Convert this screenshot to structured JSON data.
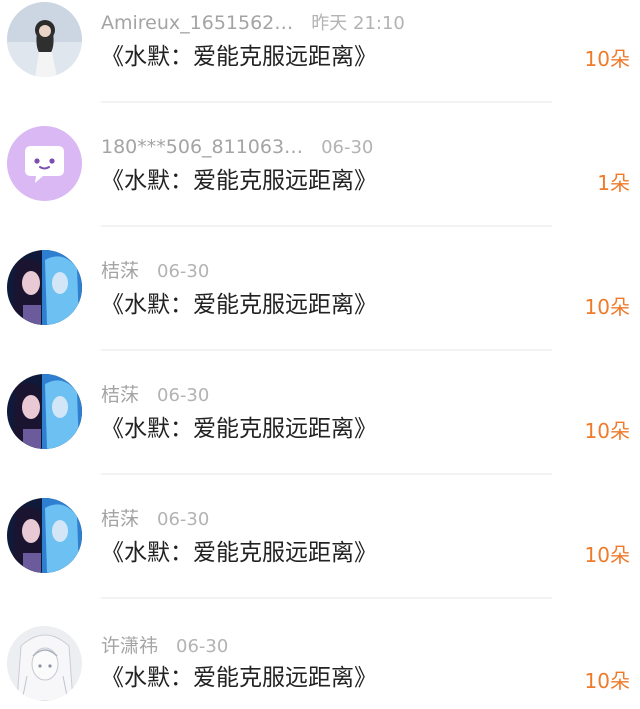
{
  "comments": [
    {
      "user": "Amireux_1651562…",
      "time": "昨天  21:10",
      "title": "《水默：爱能克服远距离》",
      "gift": "10朵",
      "avatar": "girl-photo-avatar"
    },
    {
      "user": "180***506_811063…",
      "time": "06-30",
      "title": "《水默：爱能克服远距离》",
      "gift": "1朵",
      "avatar": "default-purple-avatar"
    },
    {
      "user": "桔莯",
      "time": "06-30",
      "title": "《水默：爱能克服远距离》",
      "gift": "10朵",
      "avatar": "anime-pair-avatar"
    },
    {
      "user": "桔莯",
      "time": "06-30",
      "title": "《水默：爱能克服远距离》",
      "gift": "10朵",
      "avatar": "anime-pair-avatar"
    },
    {
      "user": "桔莯",
      "time": "06-30",
      "title": "《水默：爱能克服远距离》",
      "gift": "10朵",
      "avatar": "anime-pair-avatar"
    },
    {
      "user": "许潇祎",
      "time": "06-30",
      "title": "《水默：爱能克服远距离》",
      "gift": "10朵",
      "avatar": "sketch-girl-avatar"
    }
  ],
  "colors": {
    "gift": "#ef7a2a",
    "meta": "#a9a9a9",
    "title": "#222222",
    "default_avatar_bg": "#d9b8f4"
  }
}
